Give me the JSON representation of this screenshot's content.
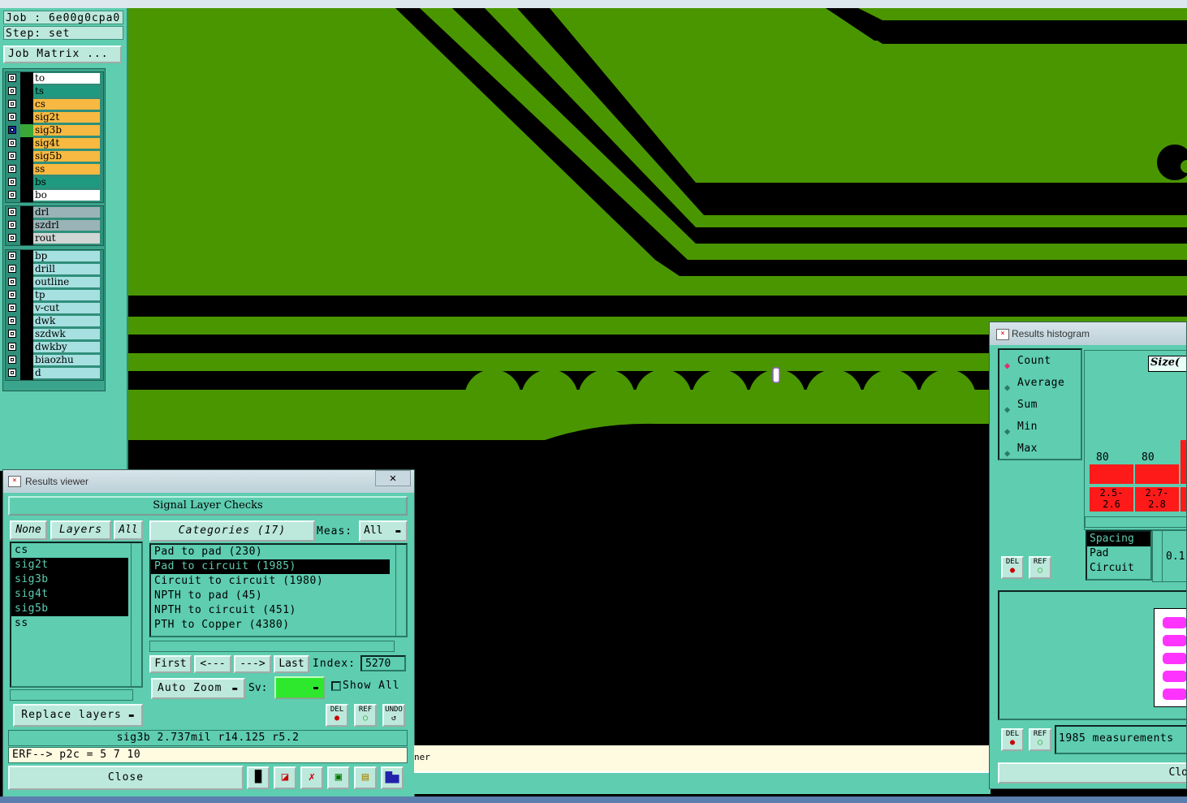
{
  "sidebar": {
    "job_label": "Job : 6e00g0cpa0",
    "step_label": "Step: set",
    "job_matrix_button": "Job Matrix ...",
    "layer_groups": [
      [
        {
          "name": "to",
          "color": "#ffffff",
          "active": false
        },
        {
          "name": "ts",
          "color": "#1f9a80",
          "active": false
        },
        {
          "name": "cs",
          "color": "#f7b941",
          "active": false
        },
        {
          "name": "sig2t",
          "color": "#f7b941",
          "active": false
        },
        {
          "name": "sig3b",
          "color": "#f7b941",
          "active": true
        },
        {
          "name": "sig4t",
          "color": "#f7b941",
          "active": false
        },
        {
          "name": "sig5b",
          "color": "#f7b941",
          "active": false
        },
        {
          "name": "ss",
          "color": "#f7b941",
          "active": false
        },
        {
          "name": "bs",
          "color": "#1f9a80",
          "active": false
        },
        {
          "name": "bo",
          "color": "#ffffff",
          "active": false
        }
      ],
      [
        {
          "name": "drl",
          "color": "#9ab3b7",
          "active": false
        },
        {
          "name": "szdrl",
          "color": "#9ab3b7",
          "active": false
        },
        {
          "name": "rout",
          "color": "#cfd6d4",
          "active": false
        }
      ],
      [
        {
          "name": "bp",
          "color": "#a6e0e0",
          "active": false
        },
        {
          "name": "drill",
          "color": "#a6e0e0",
          "active": false
        },
        {
          "name": "outline",
          "color": "#a6e0e0",
          "active": false
        },
        {
          "name": "tp",
          "color": "#a6e0e0",
          "active": false
        },
        {
          "name": "v-cut",
          "color": "#a6e0e0",
          "active": false
        },
        {
          "name": "dwk",
          "color": "#a6e0e0",
          "active": false
        },
        {
          "name": "szdwk",
          "color": "#a6e0e0",
          "active": false
        },
        {
          "name": "dwkby",
          "color": "#a6e0e0",
          "active": false
        },
        {
          "name": "biaozhu",
          "color": "#a6e0e0",
          "active": false
        },
        {
          "name": "d",
          "color": "#a6e0e0",
          "active": false
        }
      ]
    ]
  },
  "results_viewer": {
    "title": "Results viewer",
    "section_title": "Signal Layer Checks",
    "layers_header": {
      "none": "None",
      "layers": "Layers",
      "all": "All"
    },
    "layers": [
      {
        "name": "cs",
        "selected": false
      },
      {
        "name": "sig2t",
        "selected": true
      },
      {
        "name": "sig3b",
        "selected": true
      },
      {
        "name": "sig4t",
        "selected": true
      },
      {
        "name": "sig5b",
        "selected": true
      },
      {
        "name": "ss",
        "selected": false
      }
    ],
    "categories_label": "Categories (17)",
    "meas_label": "Meas:",
    "meas_value": "All",
    "categories": [
      {
        "name": "Pad to pad (230)",
        "selected": false
      },
      {
        "name": "Pad to circuit (1985)",
        "selected": true
      },
      {
        "name": "Circuit to circuit (1980)",
        "selected": false
      },
      {
        "name": "NPTH to pad (45)",
        "selected": false
      },
      {
        "name": "NPTH to circuit (451)",
        "selected": false
      },
      {
        "name": "PTH to Copper (4380)",
        "selected": false
      }
    ],
    "nav": {
      "first": "First",
      "prev": "<---",
      "next": "--->",
      "last": "Last",
      "index_label": "Index:",
      "index_value": "5270"
    },
    "auto_zoom": "Auto Zoom",
    "sv_label": "Sv:",
    "show_all": "Show All",
    "replace_layers": "Replace layers",
    "icons": {
      "del": "DEL",
      "ref": "REF",
      "undo": "UNDO"
    },
    "measurement": "sig3b 2.737mil  r14.125  r5.2",
    "erf_line": "ERF--> p2c = 5 7 10",
    "close": "Close"
  },
  "histogram": {
    "title": "Results histogram",
    "options": [
      {
        "label": "Count",
        "selected": true
      },
      {
        "label": "Average",
        "selected": false
      },
      {
        "label": "Sum",
        "selected": false
      },
      {
        "label": "Min",
        "selected": false
      },
      {
        "label": "Max",
        "selected": false
      }
    ],
    "size_label": "Size(",
    "bars": [
      {
        "count": "80",
        "range": "2.5-\n2.6"
      },
      {
        "count": "80",
        "range": "2.7-\n2.8"
      }
    ],
    "categories": [
      "Spacing",
      "Pad",
      "Circuit"
    ],
    "value_fragment": "0.1",
    "measurements": "1985 measurements",
    "close": "Clo",
    "icons": {
      "del": "DEL",
      "ref": "REF"
    }
  },
  "status": {
    "fragment": "ner"
  },
  "colors": {
    "pcb_green": "#4a9600",
    "panel_teal": "#5ecdb0",
    "light_teal": "#bde8dc",
    "bar_red": "#ff1a1a",
    "magenta": "#ff33ff"
  }
}
